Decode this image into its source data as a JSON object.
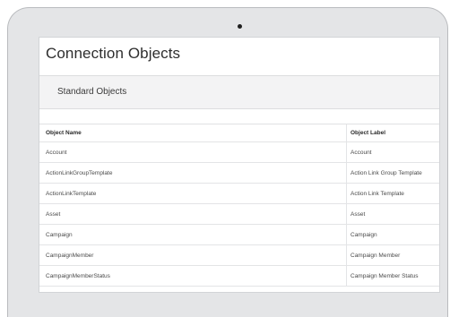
{
  "page": {
    "title": "Connection Objects"
  },
  "section": {
    "title": "Standard Objects"
  },
  "table": {
    "columns": [
      "Object Name",
      "Object Label"
    ],
    "rows": [
      {
        "name": "Account",
        "label": "Account"
      },
      {
        "name": "ActionLinkGroupTemplate",
        "label": "Action Link Group Template"
      },
      {
        "name": "ActionLinkTemplate",
        "label": "Action Link Template"
      },
      {
        "name": "Asset",
        "label": "Asset"
      },
      {
        "name": "Campaign",
        "label": "Campaign"
      },
      {
        "name": "CampaignMember",
        "label": "Campaign Member"
      },
      {
        "name": "CampaignMemberStatus",
        "label": "Campaign Member Status"
      }
    ]
  },
  "colors": {
    "frame": "#e4e5e7",
    "header_band": "#f3f3f4",
    "camera": "#1f1f1f"
  },
  "icons": {
    "camera": "webcam-icon"
  }
}
